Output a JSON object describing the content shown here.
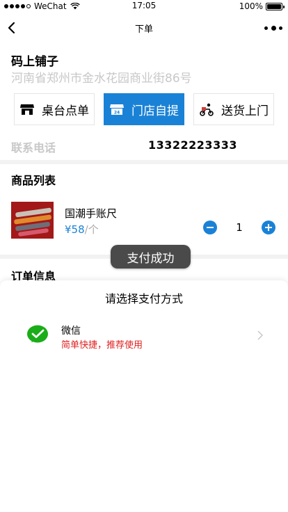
{
  "status_bar": {
    "carrier": "WeChat",
    "time": "17:05",
    "battery": "100%"
  },
  "nav": {
    "title": "下单"
  },
  "store": {
    "name": "码上铺子",
    "address": "河南省郑州市金水花园商业街86号",
    "modes": [
      {
        "label": "桌台点单",
        "icon": "store-icon",
        "active": false
      },
      {
        "label": "门店自提",
        "icon": "pickup-icon",
        "active": true
      },
      {
        "label": "送货上门",
        "icon": "delivery-icon",
        "active": false
      }
    ],
    "phone_label": "联系电话",
    "phone_value": "13322223333"
  },
  "goods": {
    "title": "商品列表",
    "items": [
      {
        "name": "国潮手账尺",
        "price": "¥58",
        "unit": "/个",
        "quantity": "1",
        "image": "product-thumbnail"
      }
    ]
  },
  "order": {
    "title": "订单信息"
  },
  "toast": {
    "text": "支付成功"
  },
  "payment": {
    "title": "请选择支付方式",
    "options": [
      {
        "name": "微信",
        "desc": "简单快捷，推荐使用",
        "icon": "wechat-pay-icon"
      }
    ]
  },
  "colors": {
    "accent": "#1a82d6",
    "muted": "#c8c8c8",
    "warning": "#e02020",
    "wechat": "#1aad19"
  }
}
